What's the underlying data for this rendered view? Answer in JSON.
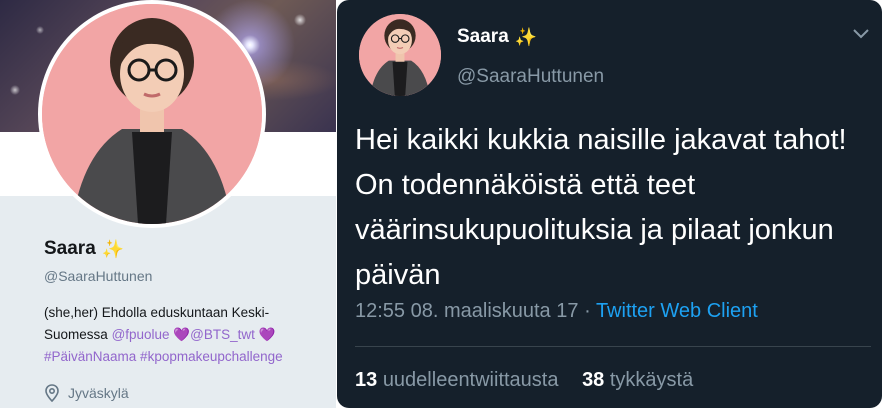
{
  "profile": {
    "name": "Saara",
    "emoji": "✨",
    "handle": "@SaaraHuttunen",
    "bio_text": "(she,her) Ehdolla eduskuntaan Keski-Suomessa",
    "bio_mention_1": "@fpuolue",
    "bio_heart": "💜",
    "bio_mention_2": "@BTS_twt",
    "bio_hashtags": "#PäivänNaama #kpopmakeupchallenge",
    "location": "Jyväskylä"
  },
  "tweet": {
    "name": "Saara",
    "emoji": "✨",
    "handle": "@SaaraHuttunen",
    "text": "Hei kaikki kukkia naisille jakavat tahot! On todennäköistä että teet väärinsukupuolituksia ja pilaat jonkun päivän",
    "timestamp": "12:55 08. maaliskuuta 17",
    "separator": "·",
    "source": "Twitter Web Client",
    "retweets_count": "13",
    "retweets_label": "uudelleentwiittausta",
    "likes_count": "38",
    "likes_label": "tykkäystä"
  },
  "colors": {
    "tweet_bg": "#15202b",
    "accent_blue": "#1da1f2",
    "link_purple": "#9266cc",
    "avatar_bg": "#f2a5a5"
  },
  "icons": [
    "location-pin-icon",
    "chevron-down-icon",
    "sparkles-emoji",
    "purple-heart-emoji"
  ]
}
